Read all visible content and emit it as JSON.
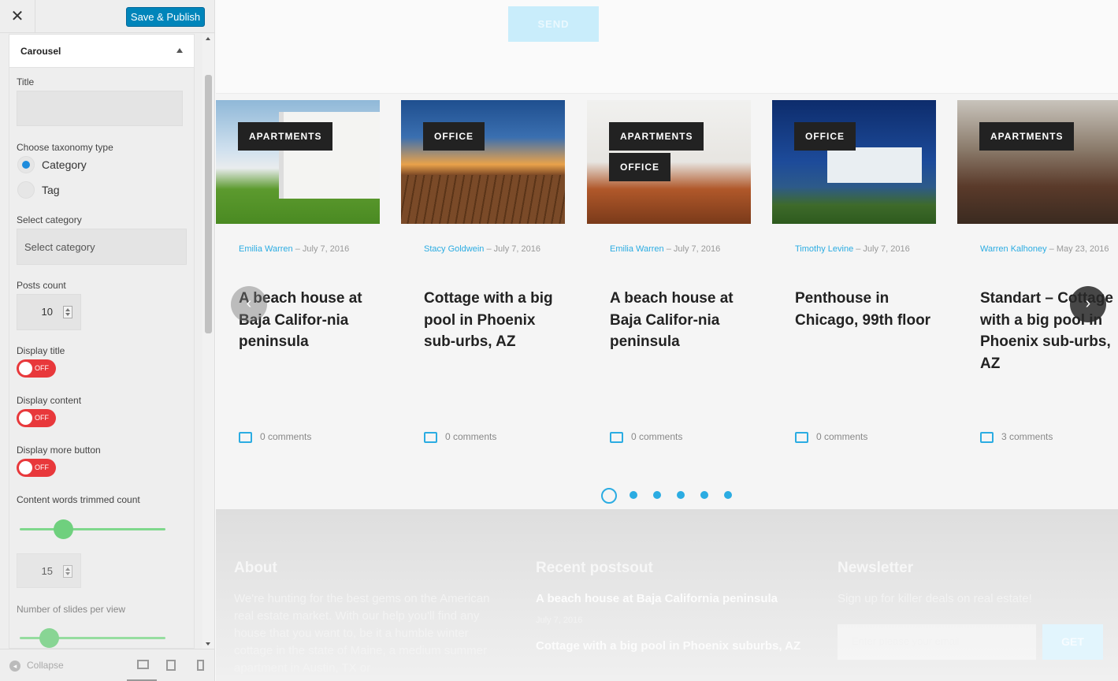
{
  "sidebar": {
    "close_icon": "✕",
    "save_label": "Save & Publish",
    "section_title": "Carousel",
    "title_label": "Title",
    "title_value": "",
    "taxonomy_label": "Choose taxonomy type",
    "taxonomy_options": [
      "Category",
      "Tag"
    ],
    "taxonomy_selected": "Category",
    "select_category_label": "Select category",
    "select_category_placeholder": "Select category",
    "posts_count_label": "Posts count",
    "posts_count_value": "10",
    "display_title_label": "Display title",
    "display_title_state": "OFF",
    "display_content_label": "Display content",
    "display_content_state": "OFF",
    "display_more_label": "Display more button",
    "display_more_state": "OFF",
    "trim_label": "Content words trimmed count",
    "trim_value": "15",
    "trim_slider_fraction": 0.3,
    "slides_label": "Number of slides per view",
    "slides_slider_fraction": 0.2,
    "collapse_label": "Collapse",
    "colors": {
      "primary": "#0085ba",
      "toggle_off": "#e8383b",
      "slider": "#7fd88c",
      "radio": "#1e8cdc"
    }
  },
  "preview": {
    "send_label": "SEND",
    "accent": "#2bace2",
    "cards": [
      {
        "tags": [
          "APARTMENTS"
        ],
        "author": "Emilia Warren",
        "date": "July 7, 2016",
        "title": "A beach house at Baja Califor-nia peninsula",
        "comments": "0 comments",
        "image": "white-villa-lawn"
      },
      {
        "tags": [
          "OFFICE"
        ],
        "author": "Stacy Goldwein",
        "date": "July 7, 2016",
        "title": "Cottage with a big pool in Phoenix sub-urbs, AZ",
        "comments": "0 comments",
        "image": "pool-deck-sunset"
      },
      {
        "tags": [
          "APARTMENTS",
          "OFFICE"
        ],
        "author": "Emilia Warren",
        "date": "July 7, 2016",
        "title": "A beach house at Baja Califor-nia peninsula",
        "comments": "0 comments",
        "image": "interior-wood-floor"
      },
      {
        "tags": [
          "OFFICE"
        ],
        "author": "Timothy Levine",
        "date": "July 7, 2016",
        "title": "Penthouse in Chicago, 99th floor",
        "comments": "0 comments",
        "image": "modern-house-night"
      },
      {
        "tags": [
          "APARTMENTS"
        ],
        "author": "Warren Kalhoney",
        "date": "May 23, 2016",
        "title": "Standart – Cottage with a big pool in Phoenix sub-urbs, AZ",
        "comments": "3 comments",
        "image": "kitchen-interior"
      }
    ],
    "pager_count": 6,
    "pager_active": 0,
    "prev_icon": "‹",
    "next_icon": "›",
    "footer": {
      "about_title": "About",
      "about_text": "We're hunting for the best gems on the American real estate market. With our help you'll find any house that you want to, be it a humble winter cottage in the state of Maine, a medium summer apartment in Austin, TX or",
      "recent_title": "Recent postsout",
      "recent_posts": [
        {
          "title": "A beach house at Baja California peninsula",
          "date": "July 7, 2016"
        },
        {
          "title": "Cottage with a big pool in Phoenix suburbs, AZ",
          "date": ""
        }
      ],
      "newsletter_title": "Newsletter",
      "newsletter_text": "Sign up for killer deals on real estate!",
      "email_placeholder": "Enter please your email",
      "get_label": "GET"
    }
  }
}
